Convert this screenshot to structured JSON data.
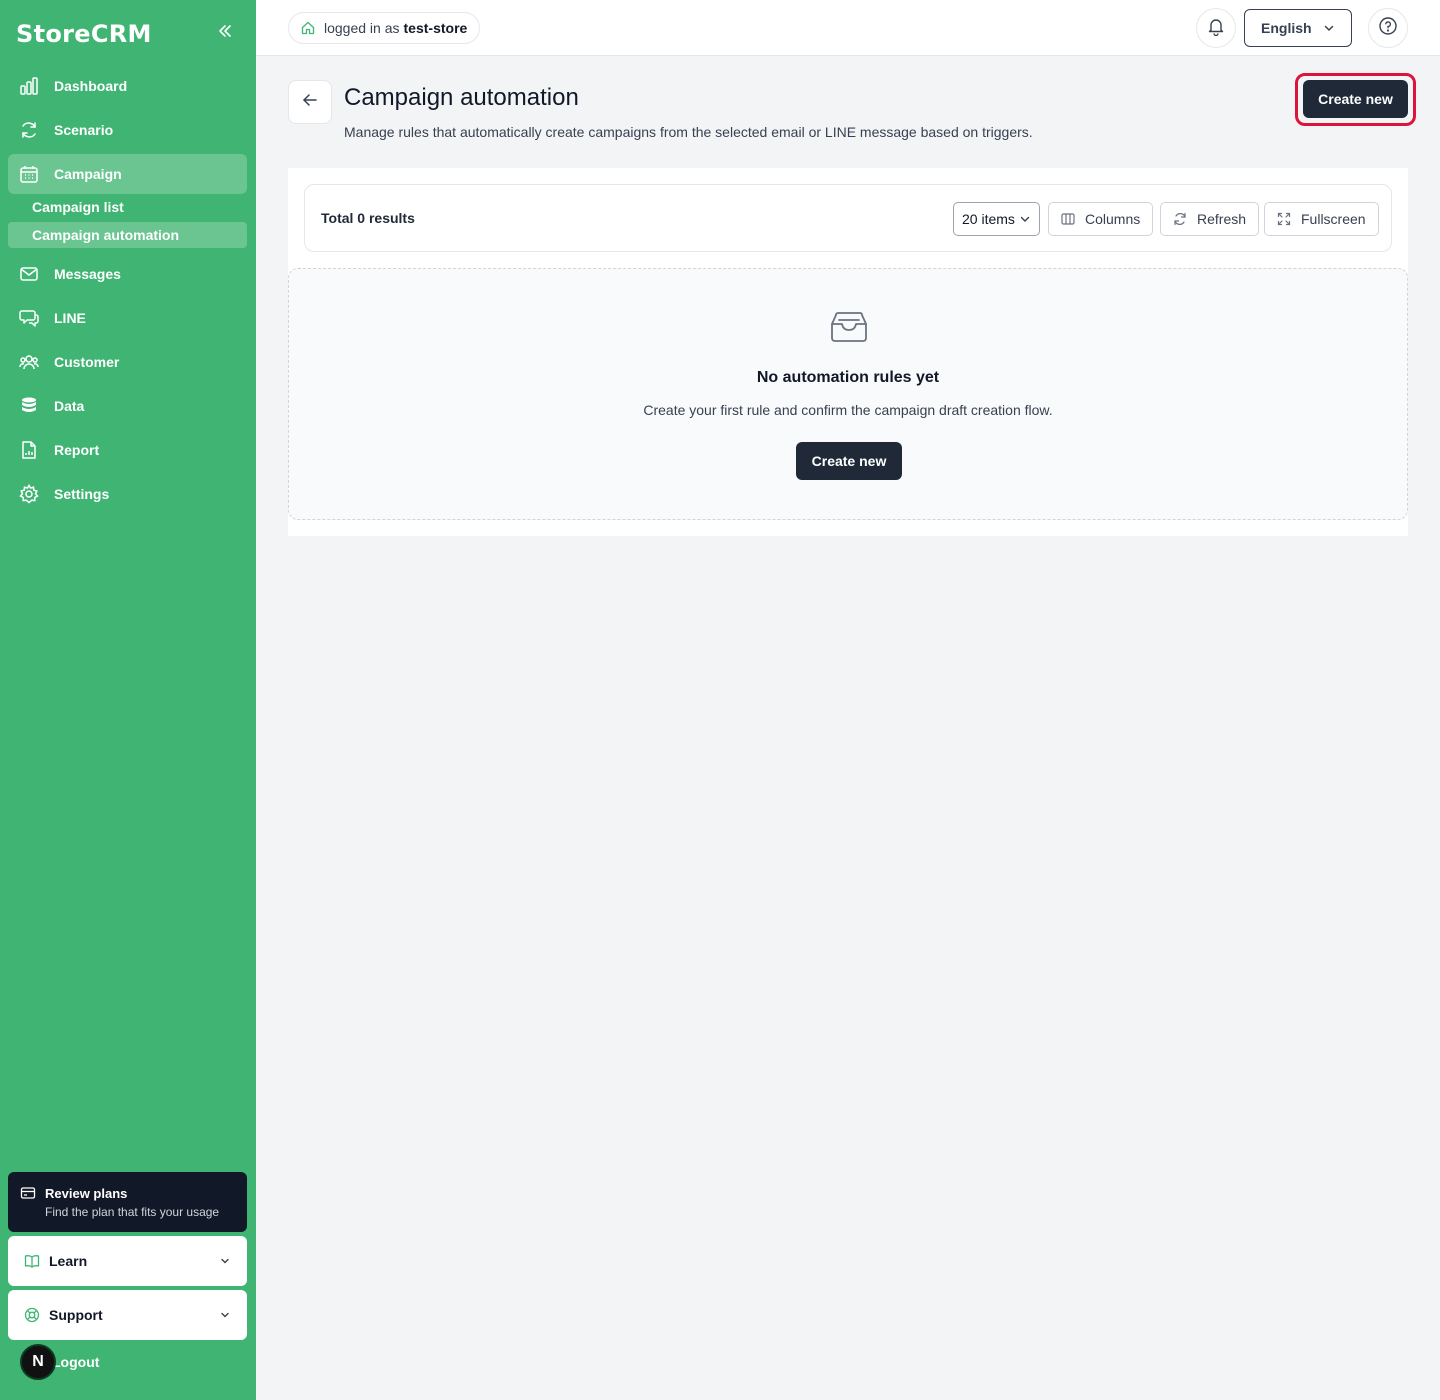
{
  "sidebar": {
    "brand": "StoreCRM",
    "nav": [
      {
        "label": "Dashboard",
        "icon": "bar-chart-icon"
      },
      {
        "label": "Scenario",
        "icon": "refresh-cycle-icon"
      },
      {
        "label": "Campaign",
        "icon": "calendar-icon",
        "active": true
      },
      {
        "label": "Messages",
        "icon": "mail-icon"
      },
      {
        "label": "LINE",
        "icon": "chat-bubbles-icon"
      },
      {
        "label": "Customer",
        "icon": "users-icon"
      },
      {
        "label": "Data",
        "icon": "database-icon"
      },
      {
        "label": "Report",
        "icon": "report-file-icon"
      },
      {
        "label": "Settings",
        "icon": "gear-icon"
      }
    ],
    "campaign_sub": [
      {
        "label": "Campaign list"
      },
      {
        "label": "Campaign automation",
        "active": true
      }
    ],
    "review": {
      "title": "Review plans",
      "desc": "Find the plan that fits your usage"
    },
    "learn": "Learn",
    "support": "Support",
    "logout": "Logout",
    "avatar_letter": "N"
  },
  "header": {
    "logged_prefix": "logged in as",
    "store": "test-store",
    "language": "English"
  },
  "page": {
    "title": "Campaign automation",
    "description": "Manage rules that automatically create campaigns from the selected email or LINE message based on triggers.",
    "create_label": "Create new"
  },
  "toolbar": {
    "total": "Total 0 results",
    "items": "20 items",
    "columns": "Columns",
    "refresh": "Refresh",
    "fullscreen": "Fullscreen"
  },
  "empty": {
    "title": "No automation rules yet",
    "desc": "Create your first rule and confirm the campaign draft creation flow.",
    "button": "Create new"
  },
  "colors": {
    "sidebar_bg": "#40b573",
    "primary_dark": "#1f2937",
    "highlight_ring": "#dc143c"
  }
}
